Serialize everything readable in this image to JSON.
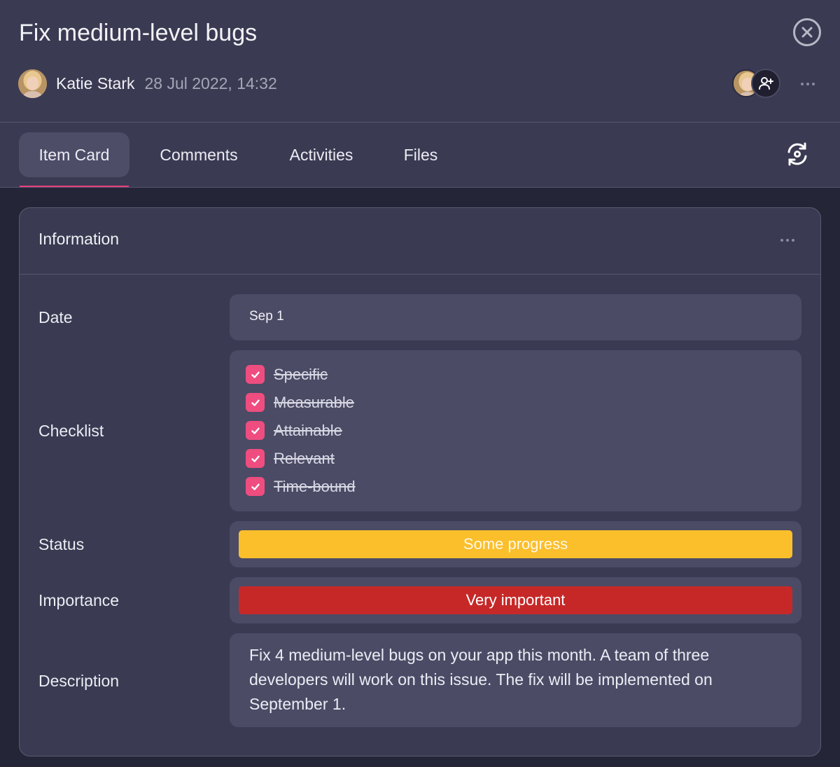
{
  "header": {
    "title": "Fix medium-level bugs",
    "author": "Katie Stark",
    "timestamp": "28 Jul 2022, 14:32",
    "close_icon": "close-circle-icon",
    "add_member_icon": "user-plus-icon",
    "more_icon": "more-horizontal-icon"
  },
  "tabs": [
    {
      "label": "Item Card",
      "active": true
    },
    {
      "label": "Comments",
      "active": false
    },
    {
      "label": "Activities",
      "active": false
    },
    {
      "label": "Files",
      "active": false
    }
  ],
  "sync_icon": "refresh-eye-icon",
  "card": {
    "title": "Information",
    "fields": {
      "date": {
        "label": "Date",
        "value": "Sep 1"
      },
      "checklist": {
        "label": "Checklist",
        "items": [
          {
            "label": "Specific",
            "checked": true
          },
          {
            "label": "Measurable",
            "checked": true
          },
          {
            "label": "Attainable",
            "checked": true
          },
          {
            "label": "Relevant",
            "checked": true
          },
          {
            "label": "Time-bound",
            "checked": true
          }
        ]
      },
      "status": {
        "label": "Status",
        "value": "Some progress",
        "color": "#fbbf2c"
      },
      "importance": {
        "label": "Importance",
        "value": "Very important",
        "color": "#c62828"
      },
      "description": {
        "label": "Description",
        "value": "Fix 4 medium-level bugs on your app this month. A team of three developers will work on this issue. The fix will be implemented on September 1."
      }
    }
  },
  "colors": {
    "accent": "#e83e7a",
    "checkbox": "#ef4d7f",
    "panel": "#3a3a52",
    "field": "#4b4b66"
  }
}
